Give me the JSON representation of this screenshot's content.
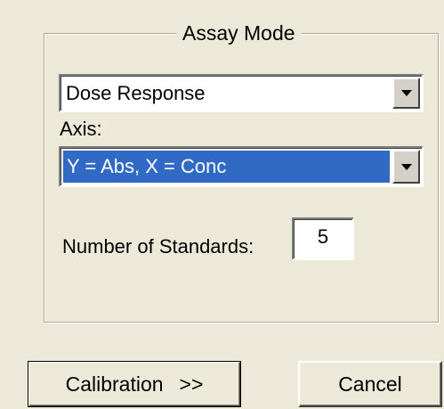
{
  "dialog": {
    "group_title": "Assay Mode",
    "assay_mode": {
      "selected": "Dose Response"
    },
    "axis": {
      "label": "Axis:",
      "selected": "Y = Abs, X = Conc"
    },
    "standards": {
      "label": "Number of Standards:",
      "value": "5"
    },
    "buttons": {
      "calibration": "Calibration",
      "calibration_suffix": ">>",
      "cancel": "Cancel"
    }
  },
  "colors": {
    "background": "#ece9d8",
    "selection": "#316ac5"
  },
  "icons": {
    "dropdown": "chevron-down-icon"
  }
}
